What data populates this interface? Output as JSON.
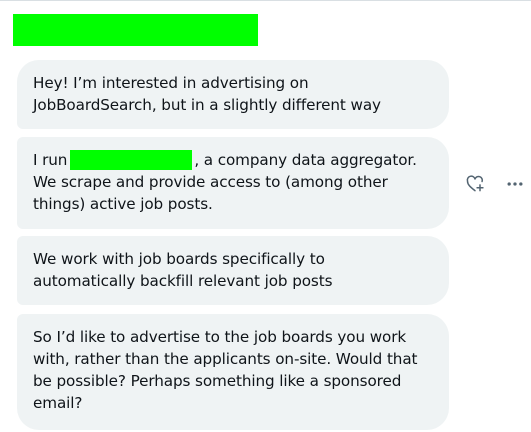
{
  "conversation": {
    "messages": [
      {
        "lines": [
          "Hey! I’m interested in advertising on",
          "JobBoardSearch, but in a slightly different way"
        ]
      },
      {
        "line1_before": "I run",
        "line1_after": ", a company data aggregator.",
        "lines_rest": [
          "We scrape and provide access to (among other",
          "things) active job posts."
        ]
      },
      {
        "lines": [
          "We work with job boards specifically to",
          "automatically backfill relevant job posts"
        ]
      },
      {
        "lines": [
          "So I’d like to advertise to the job boards you work",
          "with, rather than the applicants on-site. Would that",
          "be possible? Perhaps something like a sponsored",
          "email?"
        ]
      }
    ]
  },
  "actions": {
    "react_icon": "heart-plus-icon",
    "more_icon": "more-horizontal-icon",
    "icon_color": "#536471"
  },
  "colors": {
    "bubble_bg": "#eff3f4",
    "text": "#0f1419",
    "redaction": "#00ff00"
  }
}
